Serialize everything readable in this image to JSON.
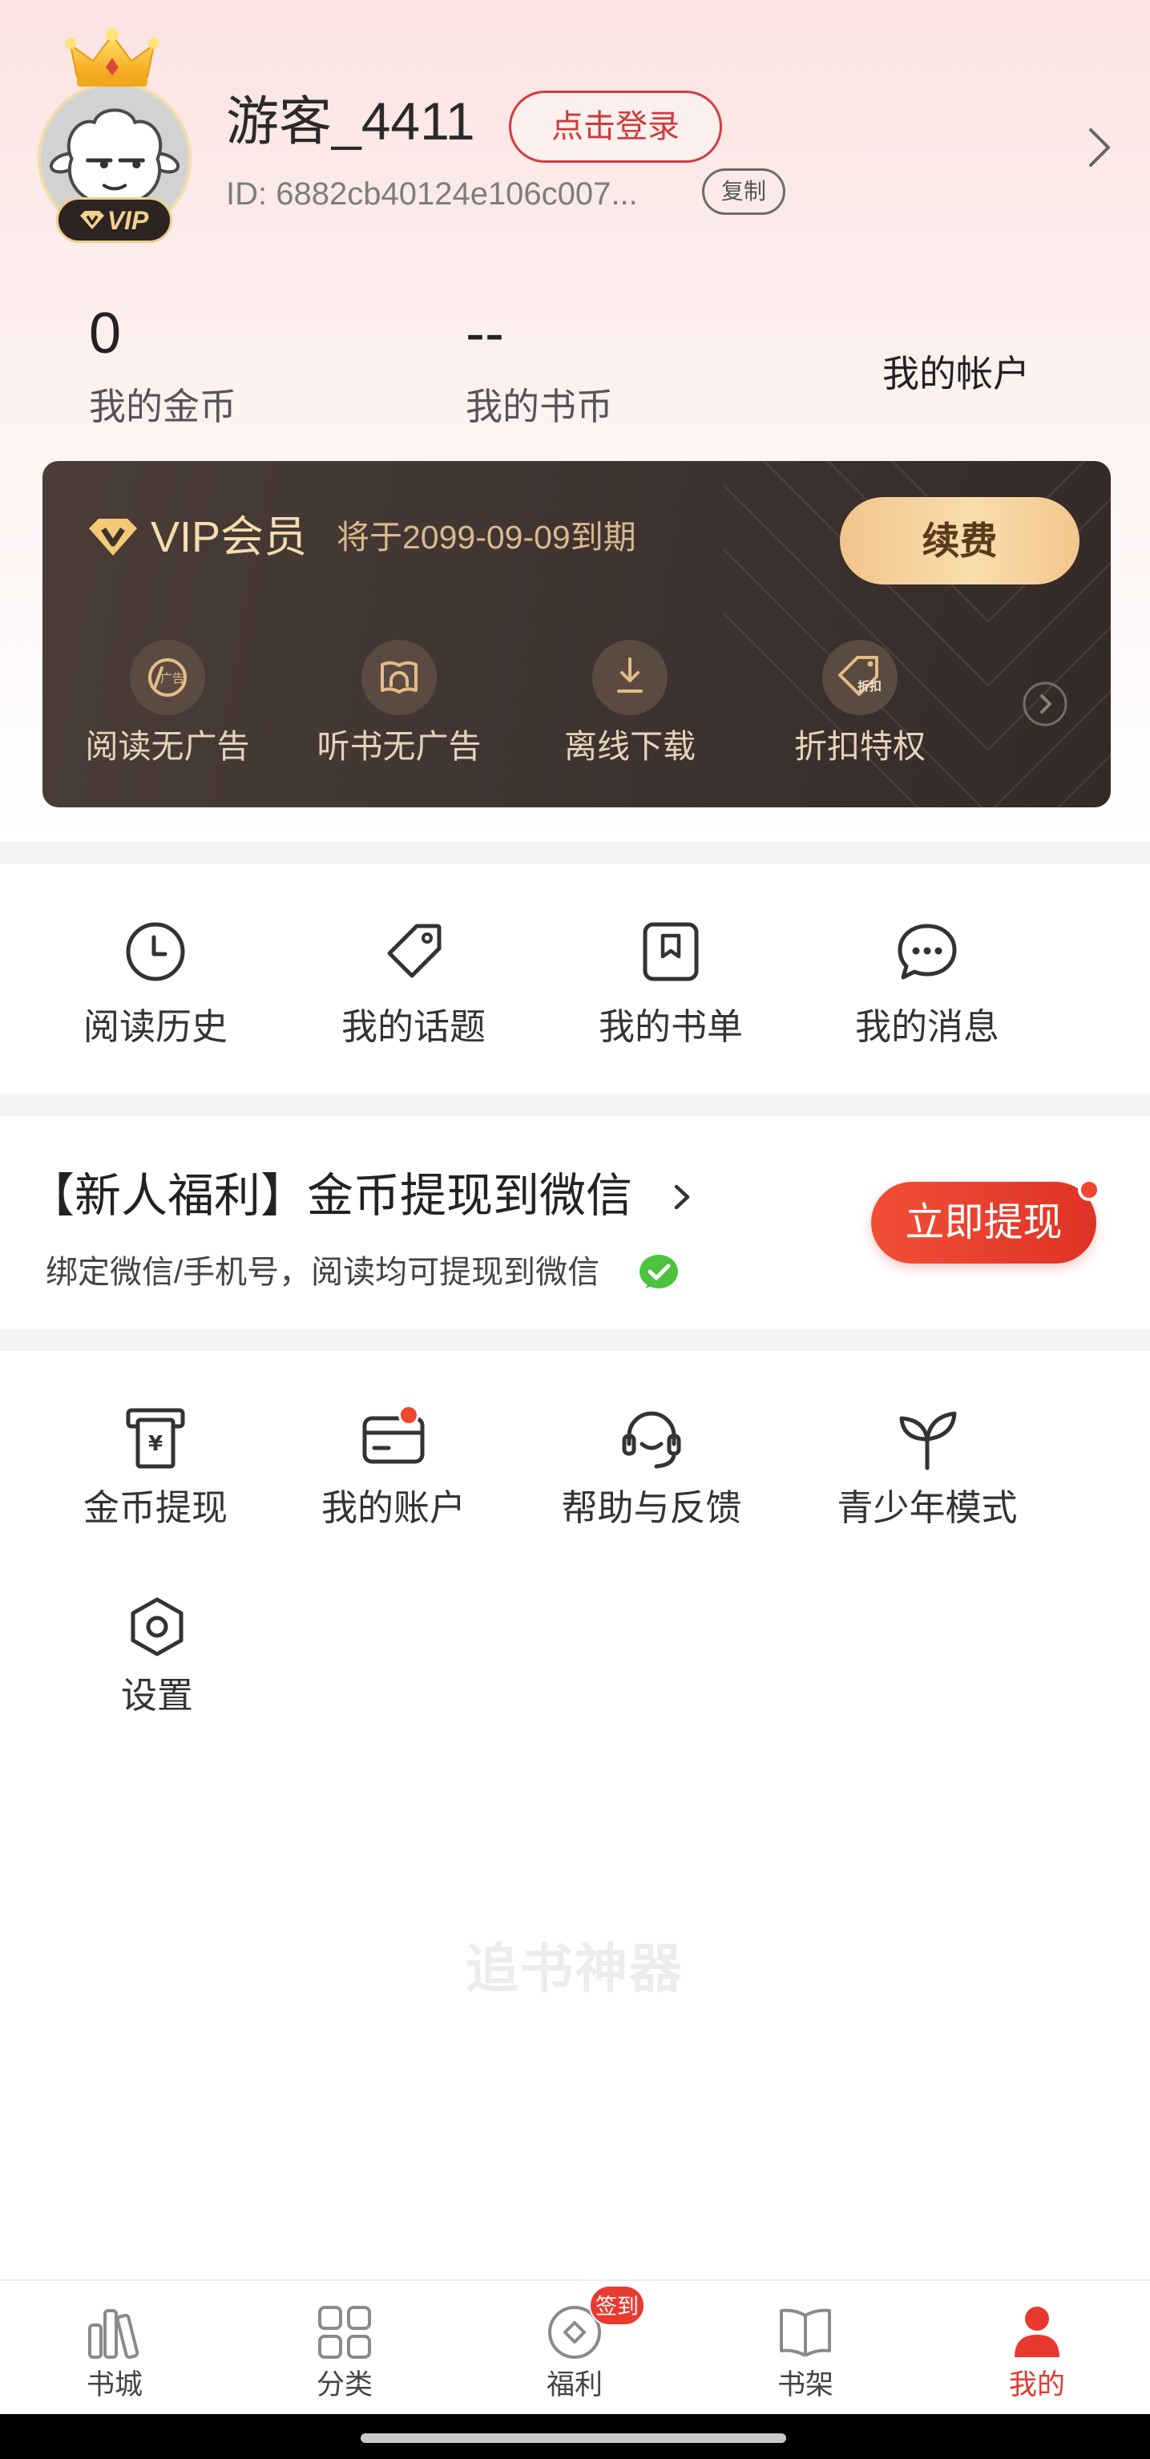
{
  "profile": {
    "name": "游客_4411",
    "login_button": "点击登录",
    "id_text": "ID: 6882cb40124e106c007...",
    "copy_button": "复制",
    "vip_badge": "VIP"
  },
  "stats": [
    {
      "value": "0",
      "label": "我的金币"
    },
    {
      "value": "--",
      "label": "我的书币"
    }
  ],
  "account_link": "我的帐户",
  "vip_card": {
    "title": "VIP会员",
    "expiry": "将于2099-09-09到期",
    "renew_button": "续费",
    "benefits": [
      {
        "icon": "no-ads-reading-icon",
        "icon_text": "广告",
        "label": "阅读无广告"
      },
      {
        "icon": "no-ads-audiobook-icon",
        "label": "听书无广告"
      },
      {
        "icon": "offline-download-icon",
        "label": "离线下载"
      },
      {
        "icon": "discount-tag-icon",
        "icon_text": "折扣",
        "label": "折扣特权"
      }
    ]
  },
  "quick_links": [
    {
      "icon": "clock-icon",
      "label": "阅读历史"
    },
    {
      "icon": "tag-icon",
      "label": "我的话题"
    },
    {
      "icon": "booklist-icon",
      "label": "我的书单"
    },
    {
      "icon": "chat-bubble-icon",
      "label": "我的消息"
    }
  ],
  "promo": {
    "title": "【新人福利】金币提现到微信",
    "subtitle": "绑定微信/手机号，阅读均可提现到微信",
    "button": "立即提现",
    "button_has_dot": true
  },
  "tools": [
    {
      "icon": "coin-withdraw-icon",
      "icon_text": "¥",
      "label": "金币提现"
    },
    {
      "icon": "wallet-card-icon",
      "label": "我的账户",
      "has_notification_dot": true
    },
    {
      "icon": "headset-icon",
      "label": "帮助与反馈"
    },
    {
      "icon": "sprout-icon",
      "label": "青少年模式"
    },
    {
      "icon": "settings-hexagon-icon",
      "label": "设置"
    }
  ],
  "watermark": "追书神器",
  "bottom_nav": [
    {
      "icon": "bookstore-icon",
      "label": "书城"
    },
    {
      "icon": "category-grid-icon",
      "label": "分类"
    },
    {
      "icon": "welfare-icon",
      "label": "福利",
      "badge": "签到"
    },
    {
      "icon": "bookshelf-icon",
      "label": "书架"
    },
    {
      "icon": "profile-person-icon",
      "label": "我的",
      "active": true
    }
  ],
  "colors": {
    "accent_red": "#e8392f",
    "vip_card_bg": "#3f3430",
    "vip_gold": "#f6dcae",
    "renew_gold": "#f9ddab",
    "wechat_green": "#4cc23f",
    "inactive_icon": "#8a8a8a"
  }
}
